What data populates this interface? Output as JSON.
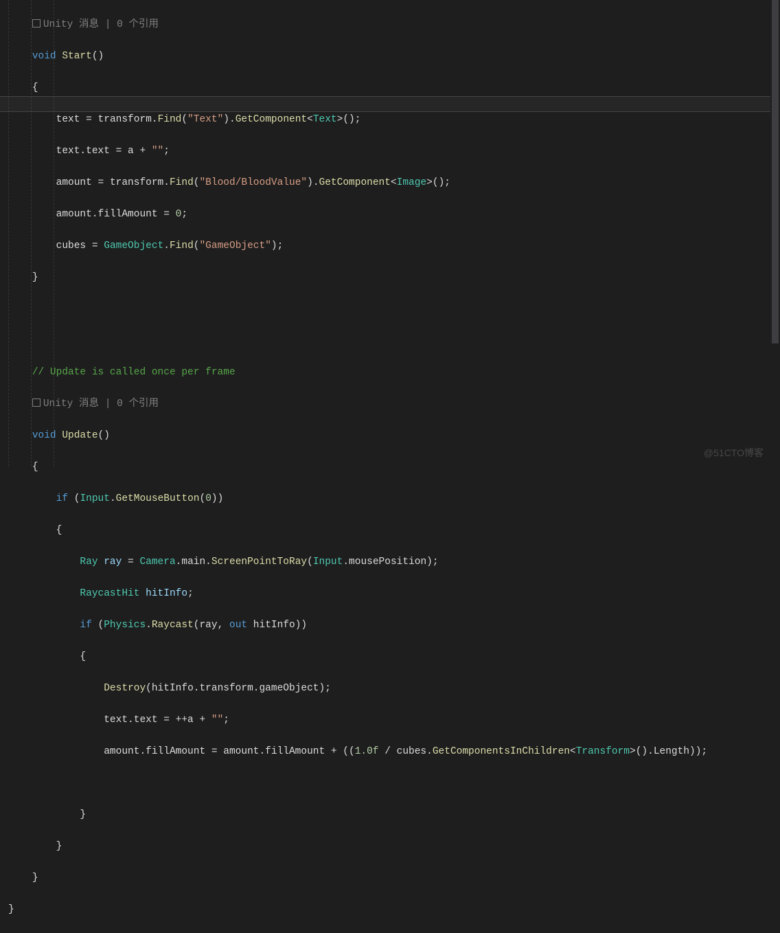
{
  "watermark": "@51CTO博客",
  "lens": {
    "icon_name": "cube-icon",
    "unity_label": "Unity 消息",
    "refs": "0 个引用"
  },
  "code": {
    "l1_kw": "void",
    "l1_fn": "Start",
    "l2": "{",
    "l3_a": "text",
    "l3_b": " = transform.",
    "l3_fn": "Find",
    "l3_s": "\"Text\"",
    "l3_c": ").",
    "l3_fn2": "GetComponent",
    "l3_t": "Text",
    "l3_end": ">();",
    "l4_a": "text.text = a + ",
    "l4_s": "\"\"",
    "l4_end": ";",
    "l5_a": "amount",
    "l5_b": " = transform.",
    "l5_fn": "Find",
    "l5_s": "\"Blood/BloodValue\"",
    "l5_c": ").",
    "l5_fn2": "GetComponent",
    "l5_t": "Image",
    "l5_end": ">();",
    "l6_a": "amount.fillAmount = ",
    "l6_n": "0",
    "l6_end": ";",
    "l7_a": "cubes",
    "l7_b": " = ",
    "l7_t": "GameObject",
    "l7_c": ".",
    "l7_fn": "Find",
    "l7_s": "\"GameObject\"",
    "l7_end": ");",
    "l8": "}",
    "lcom": "// Update is called once per frame",
    "u1_kw": "void",
    "u1_fn": "Update",
    "u2": "{",
    "u3_kw": "if",
    "u3_a": " (",
    "u3_t": "Input",
    "u3_b": ".",
    "u3_fn": "GetMouseButton",
    "u3_c": "(",
    "u3_n": "0",
    "u3_end": "))",
    "u4": "{",
    "u5_t": "Ray",
    "u5_id": " ray",
    "u5_a": " = ",
    "u5_t2": "Camera",
    "u5_b": ".main.",
    "u5_fn": "ScreenPointToRay",
    "u5_c": "(",
    "u5_t3": "Input",
    "u5_d": ".mousePosition);",
    "u6_t": "RaycastHit",
    "u6_id": " hitInfo",
    "u6_end": ";",
    "u7_kw": "if",
    "u7_a": " (",
    "u7_t": "Physics",
    "u7_b": ".",
    "u7_fn": "Raycast",
    "u7_c": "(ray, ",
    "u7_kw2": "out",
    "u7_d": " hitInfo))",
    "u8": "{",
    "u9_fn": "Destroy",
    "u9_a": "(hitInfo.transform.gameObject);",
    "u10_a": "text.text = ++a + ",
    "u10_s": "\"\"",
    "u10_end": ";",
    "u11_a": "amount.fillAmount = amount.fillAmount + ((",
    "u11_n1": "1.0f",
    "u11_b": " / cubes.",
    "u11_fn": "GetComponentsInChildren",
    "u11_c": "<",
    "u11_t": "Transform",
    "u11_d": ">().Length));",
    "u12": "}",
    "u13": "}",
    "u14": "}",
    "close": "}"
  }
}
